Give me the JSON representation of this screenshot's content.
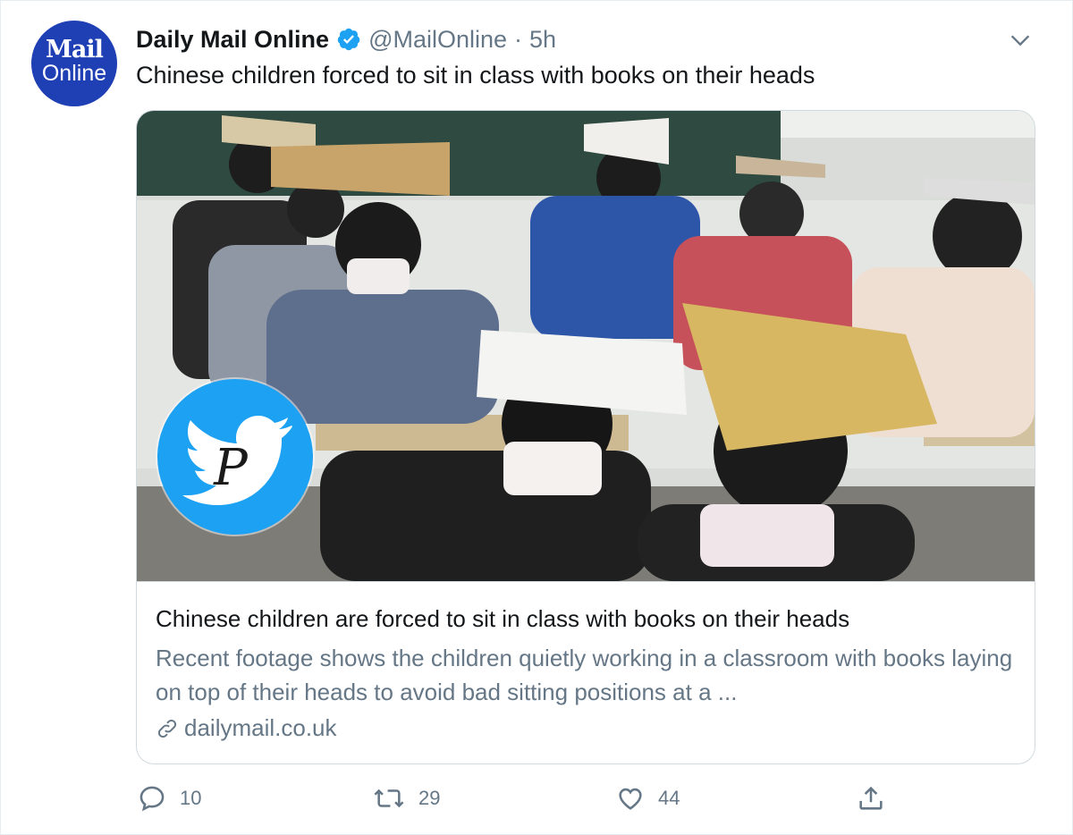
{
  "tweet": {
    "avatar": {
      "line1": "Mail",
      "line2": "Online"
    },
    "author_name": "Daily Mail Online",
    "handle": "@MailOnline",
    "separator": "·",
    "time": "5h",
    "text": "Chinese children forced to sit in class with books on their heads"
  },
  "card": {
    "title": "Chinese children are forced to sit in class with books on their heads",
    "description": "Recent footage shows the children quietly working in a classroom with books laying on top of their heads to avoid bad sitting positions at a ...",
    "domain": "dailymail.co.uk",
    "watermark_letter": "P"
  },
  "actions": {
    "reply_count": "10",
    "retweet_count": "29",
    "like_count": "44"
  },
  "colors": {
    "secondary_text": "#657786",
    "avatar_bg": "#1f3fb4",
    "twitter_blue": "#1da1f2",
    "border": "#cfd9de"
  },
  "icons": [
    "verified-icon",
    "chevron-down-icon",
    "link-icon",
    "reply-icon",
    "retweet-icon",
    "like-icon",
    "share-icon",
    "twitter-bird-icon"
  ]
}
